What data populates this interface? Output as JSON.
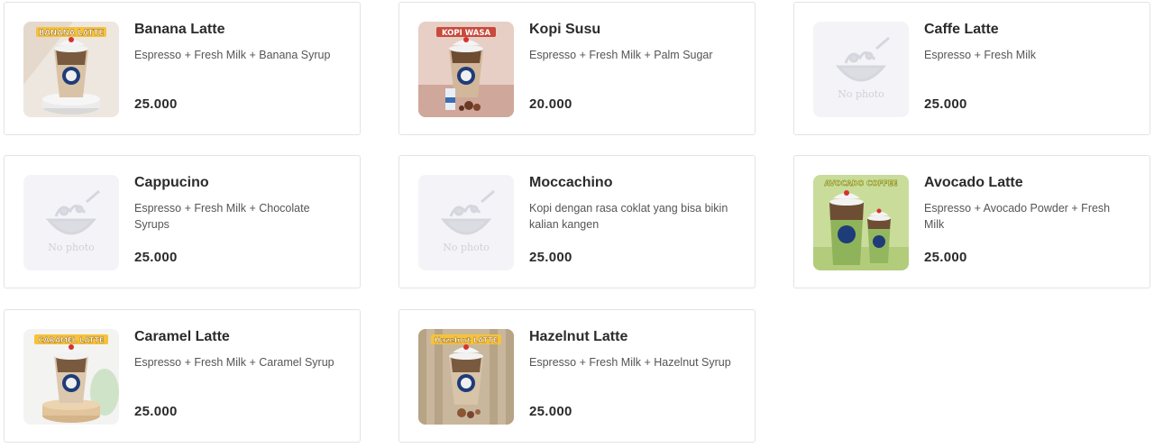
{
  "menu": {
    "items": [
      {
        "name": "Banana Latte",
        "desc": "Espresso + Fresh Milk + Banana Syrup",
        "price": "25.000",
        "image_label": "BANANA LATTE",
        "has_photo": true
      },
      {
        "name": "Kopi Susu",
        "desc": "Espresso + Fresh Milk + Palm Sugar",
        "price": "20.000",
        "image_label": "KOPI WASA",
        "has_photo": true
      },
      {
        "name": "Caffe Latte",
        "desc": "Espresso + Fresh Milk",
        "price": "25.000",
        "image_label": "",
        "has_photo": false
      },
      {
        "name": "Cappucino",
        "desc": "Espresso + Fresh Milk + Chocolate Syrups",
        "price": "25.000",
        "image_label": "",
        "has_photo": false
      },
      {
        "name": "Moccachino",
        "desc": "Kopi dengan rasa coklat yang bisa bikin kalian kangen",
        "price": "25.000",
        "image_label": "",
        "has_photo": false
      },
      {
        "name": "Avocado Latte",
        "desc": "Espresso + Avocado Powder + Fresh Milk",
        "price": "25.000",
        "image_label": "AVOCADO COFFEE",
        "has_photo": true
      },
      {
        "name": "Caramel Latte",
        "desc": "Espresso + Fresh Milk + Caramel Syrup",
        "price": "25.000",
        "image_label": "CARAMEL LATTE",
        "has_photo": true
      },
      {
        "name": "Hazelnut Latte",
        "desc": "Espresso + Fresh Milk + Hazelnut Syrup",
        "price": "25.000",
        "image_label": "Hazelnut LATTE",
        "has_photo": true
      }
    ],
    "no_photo_text": "No photo"
  },
  "colors": {
    "card_border": "#e3e3e3",
    "text_primary": "#2b2b2b",
    "text_secondary": "#555555",
    "placeholder_bg": "#f4f4f8",
    "placeholder_fg": "#d6d6de",
    "label_yellow": "#f6c23a"
  }
}
